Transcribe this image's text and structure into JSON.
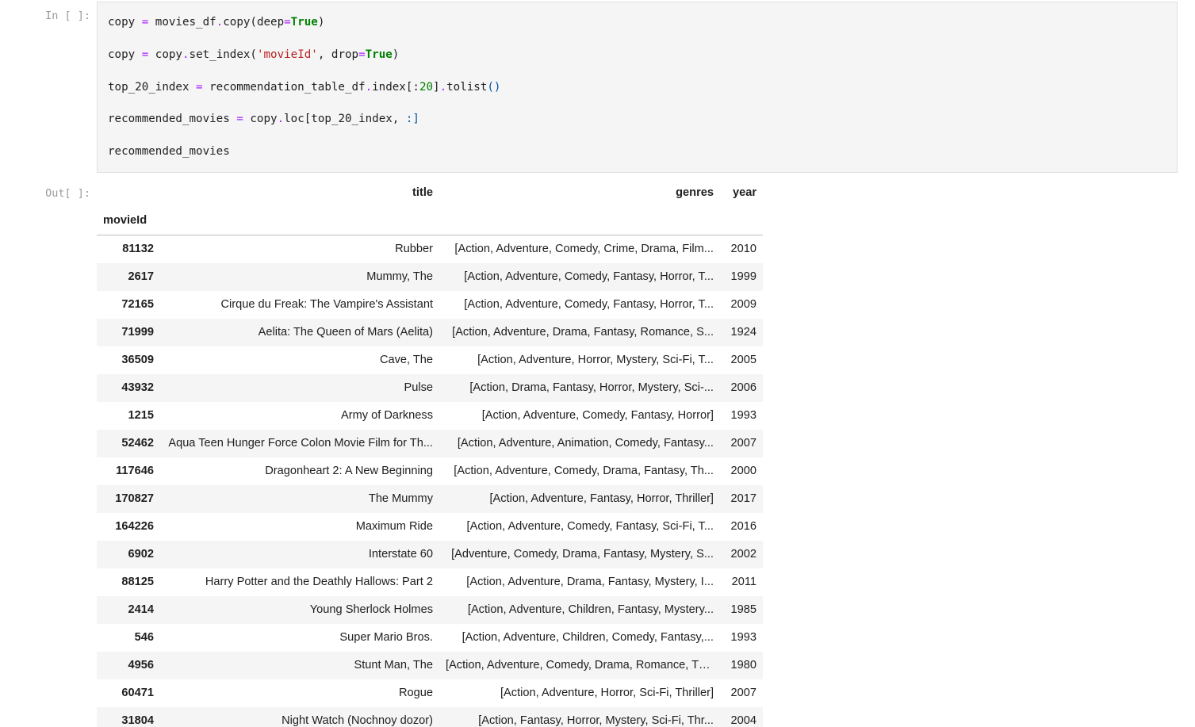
{
  "input_prompt": "In [ ]:",
  "output_prompt": "Out[ ]:",
  "code_lines": [
    [
      [
        "t",
        "copy "
      ],
      [
        "op",
        "="
      ],
      [
        "t",
        " movies_df"
      ],
      [
        "op",
        "."
      ],
      [
        "t",
        "copy(deep"
      ],
      [
        "op",
        "="
      ],
      [
        "kw",
        "True"
      ],
      [
        "t",
        ")"
      ]
    ],
    [
      [
        "t",
        "copy "
      ],
      [
        "op",
        "="
      ],
      [
        "t",
        " copy"
      ],
      [
        "op",
        "."
      ],
      [
        "t",
        "set_index("
      ],
      [
        "str",
        "'movieId'"
      ],
      [
        "t",
        ", drop"
      ],
      [
        "op",
        "="
      ],
      [
        "kw",
        "True"
      ],
      [
        "t",
        ")"
      ]
    ],
    [
      [
        "t",
        "top_20_index "
      ],
      [
        "op",
        "="
      ],
      [
        "t",
        " recommendation_table_df"
      ],
      [
        "op",
        "."
      ],
      [
        "t",
        "index[:"
      ],
      [
        "num",
        "20"
      ],
      [
        "t",
        "]"
      ],
      [
        "op",
        "."
      ],
      [
        "t",
        "tolist"
      ],
      [
        "p",
        "()"
      ]
    ],
    [
      [
        "t",
        "recommended_movies "
      ],
      [
        "op",
        "="
      ],
      [
        "t",
        " copy"
      ],
      [
        "op",
        "."
      ],
      [
        "t",
        "loc[top_20_index, "
      ],
      [
        "p",
        ":]"
      ]
    ],
    [
      [
        "t",
        "recommended_movies"
      ]
    ]
  ],
  "table": {
    "columns": [
      "title",
      "genres",
      "year"
    ],
    "index_name": "movieId",
    "rows": [
      {
        "movieId": "81132",
        "title": "Rubber",
        "genres": "[Action, Adventure, Comedy, Crime, Drama, Film...",
        "year": "2010"
      },
      {
        "movieId": "2617",
        "title": "Mummy, The",
        "genres": "[Action, Adventure, Comedy, Fantasy, Horror, T...",
        "year": "1999"
      },
      {
        "movieId": "72165",
        "title": "Cirque du Freak: The Vampire's Assistant",
        "genres": "[Action, Adventure, Comedy, Fantasy, Horror, T...",
        "year": "2009"
      },
      {
        "movieId": "71999",
        "title": "Aelita: The Queen of Mars (Aelita)",
        "genres": "[Action, Adventure, Drama, Fantasy, Romance, S...",
        "year": "1924"
      },
      {
        "movieId": "36509",
        "title": "Cave, The",
        "genres": "[Action, Adventure, Horror, Mystery, Sci-Fi, T...",
        "year": "2005"
      },
      {
        "movieId": "43932",
        "title": "Pulse",
        "genres": "[Action, Drama, Fantasy, Horror, Mystery, Sci-...",
        "year": "2006"
      },
      {
        "movieId": "1215",
        "title": "Army of Darkness",
        "genres": "[Action, Adventure, Comedy, Fantasy, Horror]",
        "year": "1993"
      },
      {
        "movieId": "52462",
        "title": "Aqua Teen Hunger Force Colon Movie Film for Th...",
        "genres": "[Action, Adventure, Animation, Comedy, Fantasy...",
        "year": "2007"
      },
      {
        "movieId": "117646",
        "title": "Dragonheart 2: A New Beginning",
        "genres": "[Action, Adventure, Comedy, Drama, Fantasy, Th...",
        "year": "2000"
      },
      {
        "movieId": "170827",
        "title": "The Mummy",
        "genres": "[Action, Adventure, Fantasy, Horror, Thriller]",
        "year": "2017"
      },
      {
        "movieId": "164226",
        "title": "Maximum Ride",
        "genres": "[Action, Adventure, Comedy, Fantasy, Sci-Fi, T...",
        "year": "2016"
      },
      {
        "movieId": "6902",
        "title": "Interstate 60",
        "genres": "[Adventure, Comedy, Drama, Fantasy, Mystery, S...",
        "year": "2002"
      },
      {
        "movieId": "88125",
        "title": "Harry Potter and the Deathly Hallows: Part 2",
        "genres": "[Action, Adventure, Drama, Fantasy, Mystery, I...",
        "year": "2011"
      },
      {
        "movieId": "2414",
        "title": "Young Sherlock Holmes",
        "genres": "[Action, Adventure, Children, Fantasy, Mystery...",
        "year": "1985"
      },
      {
        "movieId": "546",
        "title": "Super Mario Bros.",
        "genres": "[Action, Adventure, Children, Comedy, Fantasy,...",
        "year": "1993"
      },
      {
        "movieId": "4956",
        "title": "Stunt Man, The",
        "genres": "[Action, Adventure, Comedy, Drama, Romance, Th...",
        "year": "1980"
      },
      {
        "movieId": "60471",
        "title": "Rogue",
        "genres": "[Action, Adventure, Horror, Sci-Fi, Thriller]",
        "year": "2007"
      },
      {
        "movieId": "31804",
        "title": "Night Watch (Nochnoy dozor)",
        "genres": "[Action, Fantasy, Horror, Mystery, Sci-Fi, Thr...",
        "year": "2004"
      }
    ]
  }
}
